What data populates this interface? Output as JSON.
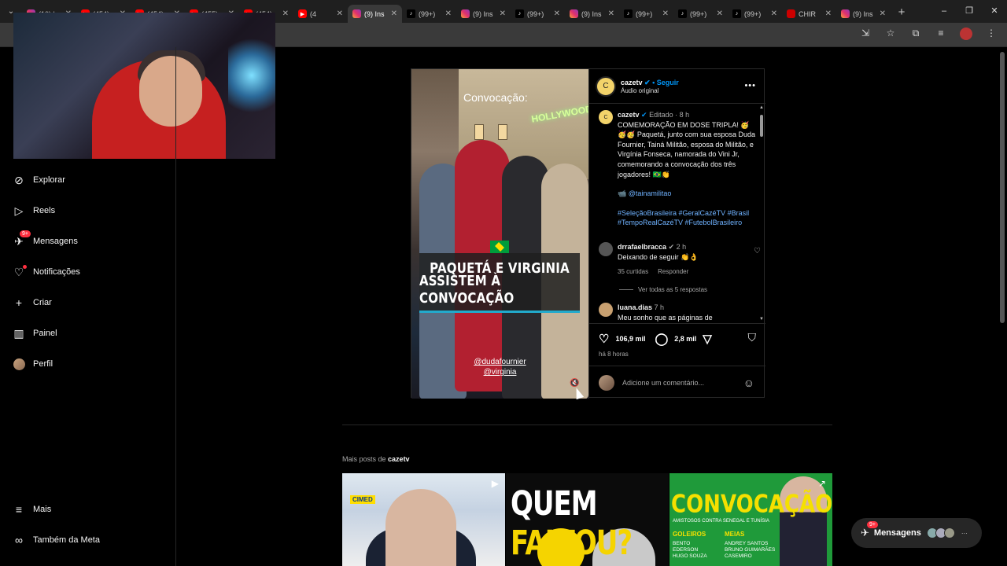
{
  "browser": {
    "tabs": [
      {
        "title": "(10) |",
        "type": "ig"
      },
      {
        "title": "(454)",
        "type": "yt"
      },
      {
        "title": "(454)",
        "type": "yt"
      },
      {
        "title": "(455)",
        "type": "yt"
      },
      {
        "title": "(454)",
        "type": "yt"
      },
      {
        "title": "(4",
        "type": "yt"
      },
      {
        "title": "(9) Ins",
        "type": "ig",
        "active": true
      },
      {
        "title": "(99+)",
        "type": "tt"
      },
      {
        "title": "(9) Ins",
        "type": "ig"
      },
      {
        "title": "(99+)",
        "type": "tt"
      },
      {
        "title": "(9) Ins",
        "type": "ig"
      },
      {
        "title": "(99+)",
        "type": "tt"
      },
      {
        "title": "(99+)",
        "type": "tt"
      },
      {
        "title": "(99+)",
        "type": "tt"
      },
      {
        "title": "CHIR",
        "type": "chir"
      },
      {
        "title": "(9) Ins",
        "type": "ig"
      }
    ],
    "new_tab": "+",
    "window_controls": [
      "–",
      "❐",
      "✕"
    ]
  },
  "sidebar": {
    "items": [
      {
        "label": "Explorar",
        "icon": "compass-icon"
      },
      {
        "label": "Reels",
        "icon": "reels-icon"
      },
      {
        "label": "Mensagens",
        "icon": "messenger-icon",
        "badge": "9+"
      },
      {
        "label": "Notificações",
        "icon": "heart-icon"
      },
      {
        "label": "Criar",
        "icon": "plus-icon"
      },
      {
        "label": "Painel",
        "icon": "dashboard-icon"
      },
      {
        "label": "Perfil",
        "icon": "avatar"
      }
    ],
    "bottom": [
      {
        "label": "Mais",
        "icon": "menu-icon"
      },
      {
        "label": "Também da Meta",
        "icon": "meta-icon"
      }
    ]
  },
  "post": {
    "media": {
      "overlay_top": "Convocação:",
      "neon": "HOLLYWOOD",
      "headline_1": "PAQUETÁ E VIRGINIA",
      "headline_2": "ASSISTEM À CONVOCAÇÃO",
      "handle_1": "@dudafournier",
      "handle_2": "@virginia"
    },
    "header": {
      "username": "cazetv",
      "verified": "✔",
      "follow": "• Seguir",
      "audio": "Áudio original"
    },
    "caption": {
      "username": "cazetv",
      "verified": "✔",
      "meta": "Editado · 8 h",
      "text": "COMEMORAÇÃO EM DOSE TRIPLA! 🥳🥳🥳 Paquetá, junto com sua esposa Duda Fournier, Tainá Militão, esposa do Militão, e Virgínia Fonseca, namorada do Vini Jr, comemorando a convocação dos três jogadores! 🇧🇷👏",
      "mention": "📹 @tainamilitao",
      "tags": "#SeleçãoBrasileira #GeralCazéTV #Brasil #TempoRealCazéTV #FutebolBrasileiro"
    },
    "comments": [
      {
        "username": "drrafaelbracca",
        "meta": "✔ 2 h",
        "text": "Deixando de seguir 👏👌",
        "likes": "35 curtidas",
        "reply": "Responder"
      },
      {
        "username": "luana.dias",
        "meta": "7 h",
        "text": "Meu sonho que as páginas de"
      }
    ],
    "see_all": "Ver todas as 5 respostas",
    "likes": "106,9 mil",
    "comments_count": "2,8 mil",
    "time": "há 8 horas",
    "add_comment_placeholder": "Adicione um comentário..."
  },
  "more_posts": {
    "prefix": "Mais posts de",
    "user": "cazetv",
    "thumb2_a": "QUEM ",
    "thumb2_b": "FALTOU?",
    "thumb3_title": "CONVOCAÇÃO",
    "thumb3_sub": "AMISTOSOS CONTRA SENEGAL E TUNÍSIA",
    "thumb3_col1": "GOLEIROS",
    "thumb3_col2": "MEIAS",
    "thumb3_names1": "BENTO\nEDERSON\nHUGO SOUZA",
    "thumb3_names2": "ANDREY SANTOS\nBRUNO GUIMARÃES\nCASEMIRO",
    "thumb1_logo": "CIMED"
  },
  "messages_pill": {
    "label": "Mensagens",
    "badge": "9+",
    "more": "···"
  }
}
